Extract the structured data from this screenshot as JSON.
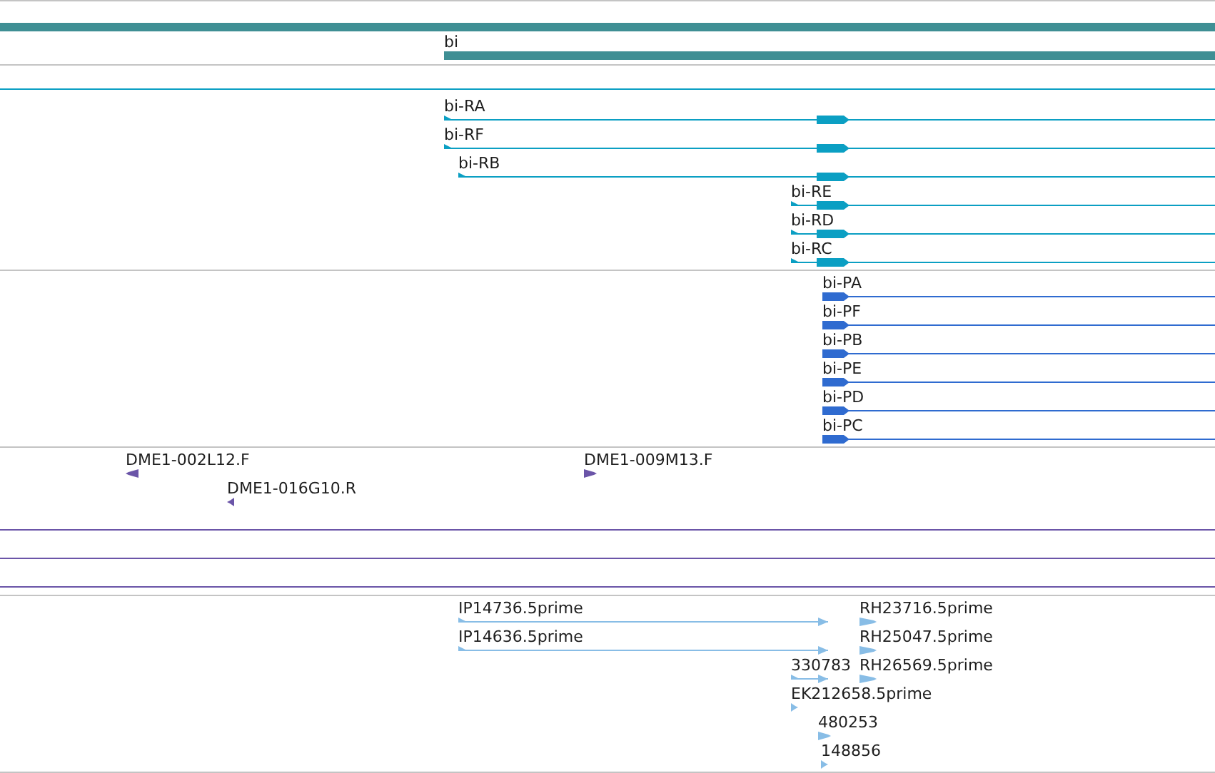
{
  "tracks": [
    {
      "kind": "gene",
      "features": [
        {
          "label": "bi"
        }
      ]
    },
    {
      "kind": "transcript",
      "features": [
        {
          "label": "bi-RA",
          "reverse": false
        },
        {
          "label": "bi-RF",
          "reverse": false
        },
        {
          "label": "bi-RB",
          "reverse": false
        },
        {
          "label": "bi-RE",
          "reverse": false
        },
        {
          "label": "bi-RD",
          "reverse": false
        },
        {
          "label": "bi-RC",
          "reverse": false
        }
      ]
    },
    {
      "kind": "protein",
      "features": [
        {
          "label": "bi-PA",
          "reverse": false
        },
        {
          "label": "bi-PF",
          "reverse": false
        },
        {
          "label": "bi-PB",
          "reverse": false
        },
        {
          "label": "bi-PE",
          "reverse": false
        },
        {
          "label": "bi-PD",
          "reverse": false
        },
        {
          "label": "bi-PC",
          "reverse": false
        }
      ]
    },
    {
      "kind": "clone",
      "features": [
        {
          "label": "DME1-002L12.F",
          "reverse": true
        },
        {
          "label": "DME1-009M13.F",
          "reverse": false
        },
        {
          "label": "DME1-016G10.R",
          "reverse": true
        }
      ]
    },
    {
      "kind": "est",
      "features": [
        {
          "label": "IP14736.5prime",
          "reverse": false
        },
        {
          "label": "RH23716.5prime",
          "reverse": false
        },
        {
          "label": "IP14636.5prime",
          "reverse": false
        },
        {
          "label": "RH25047.5prime",
          "reverse": false
        },
        {
          "label": "330783",
          "reverse": false
        },
        {
          "label": "RH26569.5prime",
          "reverse": false
        },
        {
          "label": "EK212658.5prime",
          "reverse": false
        },
        {
          "label": "480253",
          "reverse": false
        },
        {
          "label": "148856",
          "reverse": false
        }
      ]
    }
  ]
}
